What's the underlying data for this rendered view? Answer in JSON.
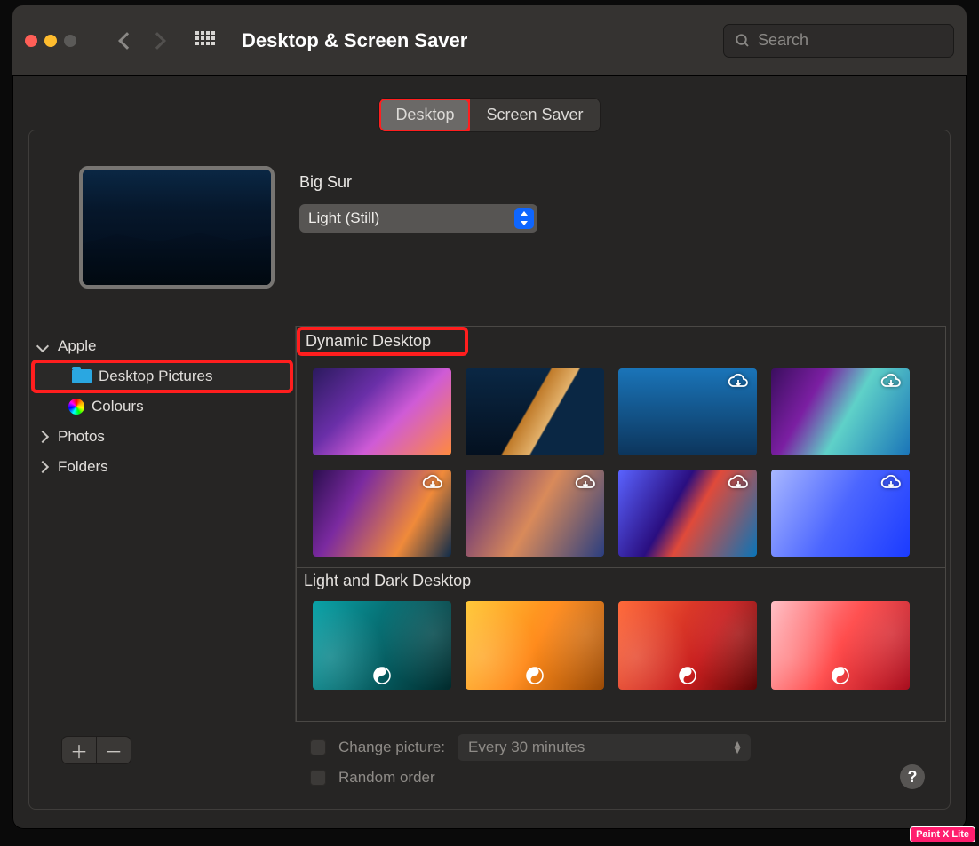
{
  "window": {
    "title": "Desktop & Screen Saver"
  },
  "search": {
    "placeholder": "Search"
  },
  "tabs": {
    "desktop": "Desktop",
    "screensaver": "Screen Saver",
    "active": "desktop"
  },
  "current": {
    "name": "Big Sur",
    "mode": "Light (Still)"
  },
  "sidebar": {
    "apple": "Apple",
    "desktop_pictures": "Desktop Pictures",
    "colours": "Colours",
    "photos": "Photos",
    "folders": "Folders"
  },
  "sections": {
    "dynamic": "Dynamic Desktop",
    "lightdark": "Light and Dark Desktop"
  },
  "bottom": {
    "change_label": "Change picture:",
    "interval": "Every 30 minutes",
    "random_label": "Random order"
  },
  "badge": "Paint X Lite"
}
